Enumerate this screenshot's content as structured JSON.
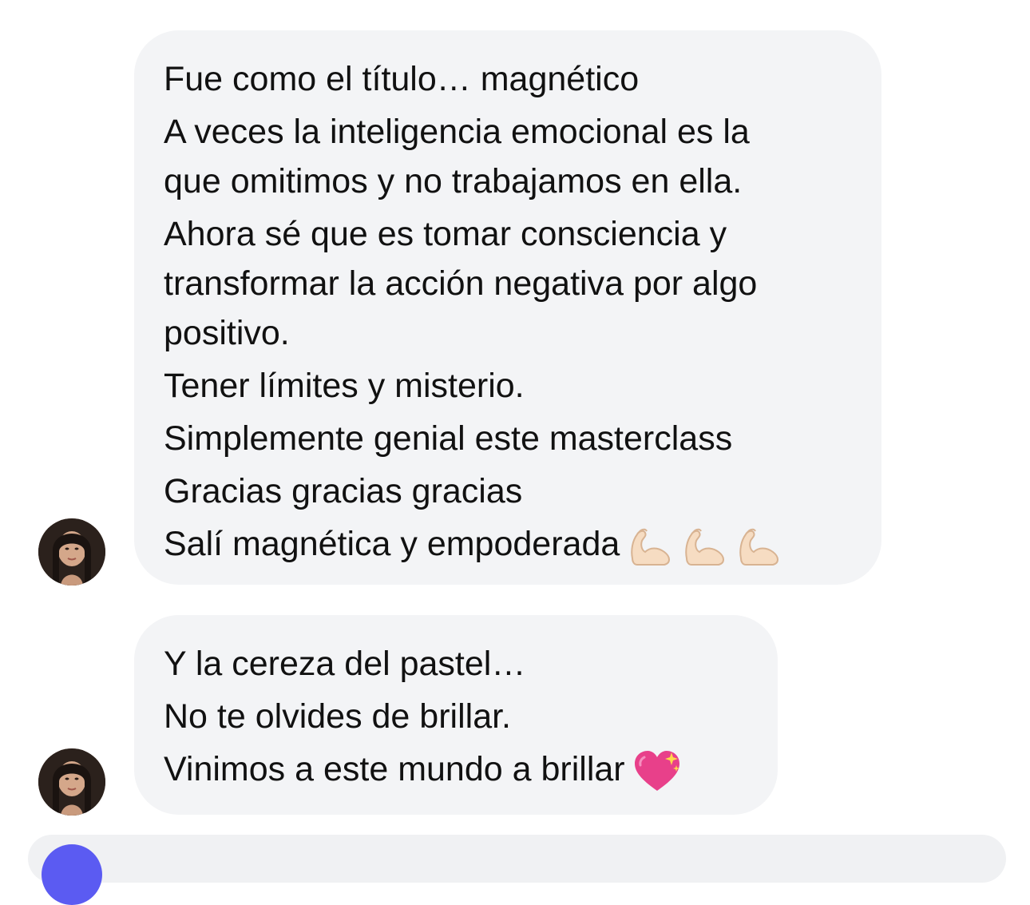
{
  "messages": [
    {
      "lines": [
        "Fue como el título… magnético",
        "A veces la inteligencia emocional es la",
        "que omitimos y no trabajamos en ella.",
        "Ahora sé que es tomar consciencia y",
        "transformar la acción negativa por algo",
        "positivo.",
        "Tener límites y misterio.",
        "Simplemente genial este masterclass",
        "Gracias gracias gracias",
        "Salí magnética y empoderada"
      ],
      "emoji": [
        "flexed-biceps-icon",
        "flexed-biceps-icon",
        "flexed-biceps-icon"
      ]
    },
    {
      "lines": [
        "Y la cereza del pastel…",
        "No te olvides de brillar.",
        "Vinimos a este mundo a brillar"
      ],
      "emoji": [
        "sparkling-heart-icon"
      ]
    }
  ],
  "colors": {
    "bubble_bg": "#f3f4f6",
    "text": "#111111",
    "accent": "#5b5bf2"
  }
}
